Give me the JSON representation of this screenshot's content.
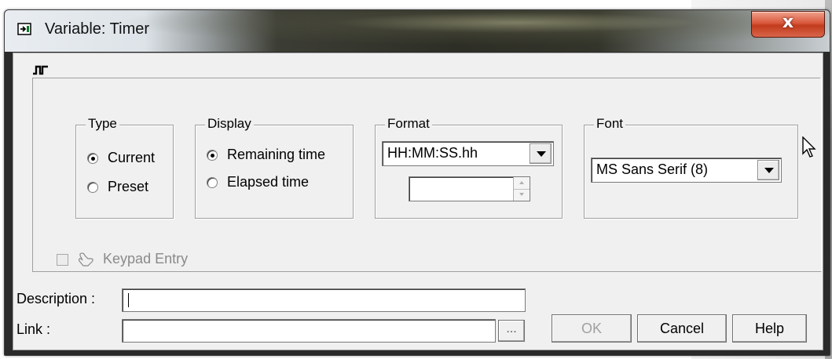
{
  "window": {
    "title": "Variable: Timer",
    "close_label": "x"
  },
  "groups": {
    "type": {
      "title": "Type",
      "options": [
        "Current",
        "Preset"
      ],
      "selected": "Current"
    },
    "display": {
      "title": "Display",
      "options": [
        "Remaining time",
        "Elapsed time"
      ],
      "selected": "Remaining time"
    },
    "format": {
      "title": "Format",
      "value": "HH:MM:SS.hh",
      "spin_value": ""
    },
    "font": {
      "title": "Font",
      "value": "MS Sans Serif (8)"
    }
  },
  "keypad": {
    "label": "Keypad Entry",
    "checked": false
  },
  "fields": {
    "description_label": "Description :",
    "description_value": "",
    "link_label": "Link  :",
    "link_value": "",
    "browse_label": "..."
  },
  "buttons": {
    "ok": "OK",
    "cancel": "Cancel",
    "help": "Help"
  }
}
